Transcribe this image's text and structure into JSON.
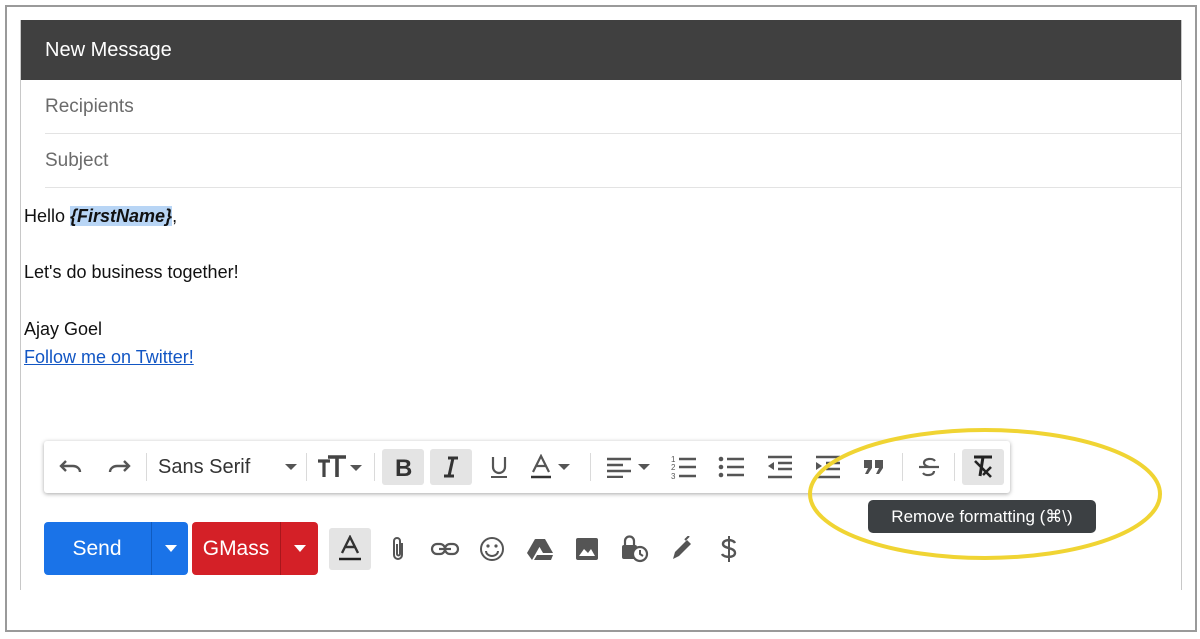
{
  "window": {
    "title": "New Message"
  },
  "fields": {
    "recipients_placeholder": "Recipients",
    "subject_placeholder": "Subject"
  },
  "body": {
    "greeting_prefix": "Hello ",
    "merge_tag": "{FirstName}",
    "greeting_suffix": ",",
    "line2": "Let's do business together!",
    "signature_name": "Ajay Goel",
    "signature_link": "Follow me on Twitter!"
  },
  "toolbar": {
    "font_family": "Sans Serif",
    "items": [
      "undo-icon",
      "redo-icon",
      "font-family",
      "text-size-icon",
      "bold-icon",
      "italic-icon",
      "underline-icon",
      "text-color-icon",
      "align-icon",
      "numbered-list-icon",
      "bulleted-list-icon",
      "indent-less-icon",
      "indent-more-icon",
      "quote-icon",
      "strikethrough-icon",
      "remove-formatting-icon"
    ],
    "active": [
      "bold-icon",
      "italic-icon",
      "remove-formatting-icon"
    ]
  },
  "tooltip": {
    "text": "Remove formatting (⌘\\)"
  },
  "actions": {
    "send_label": "Send",
    "gmass_label": "GMass",
    "icons": [
      "formatting-options-icon",
      "attach-icon",
      "link-icon",
      "emoji-icon",
      "drive-icon",
      "photo-icon",
      "confidential-mode-icon",
      "signature-icon",
      "dollar-icon"
    ]
  },
  "colors": {
    "titlebar": "#404040",
    "send": "#1a73e8",
    "gmass": "#d42027",
    "highlight": "#b8d5f5",
    "annotation_ellipse": "#f0d433",
    "link": "#1256c4"
  }
}
